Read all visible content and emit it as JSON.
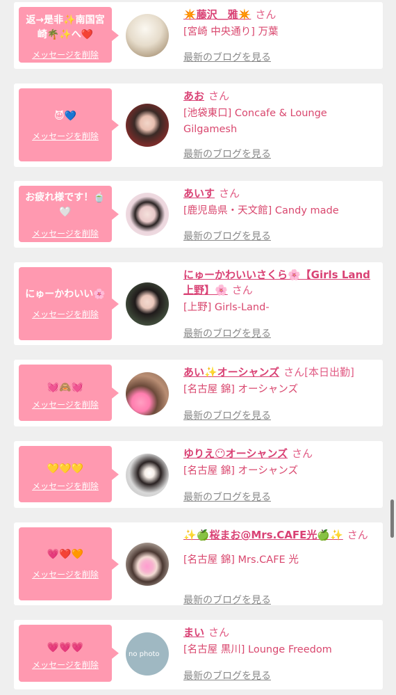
{
  "delete_label": "メッセージを削除",
  "blog_label": "最新のブログを見る",
  "san": "さん",
  "colors": {
    "bubble": "#ff99b0",
    "link": "#d94174",
    "shop": "#d9476e",
    "muted": "#888888",
    "bg": "#efefef"
  },
  "items": [
    {
      "message": "返→是非✨南国宮崎🌴✨へ❤️",
      "name": "✴️藤沢＿雅✴️",
      "tag": "",
      "shop": "[宮崎 中央通り] 万葉",
      "avatar_icon": "blurred-photo-avatar"
    },
    {
      "message": "😈💙",
      "name": "あお",
      "tag": "",
      "shop": "[池袋東口] Concafe & Lounge Gilgamesh",
      "avatar_icon": "girl-photo-avatar"
    },
    {
      "message": "お疲れ様です！🍵🤍",
      "name": "あいす",
      "tag": "",
      "shop": "[鹿児島県・天文館] Candy made",
      "avatar_icon": "girl-photo-avatar"
    },
    {
      "message": "にゅーかわいい🌸",
      "name": "にゅーかわいいさくら🌸【Girls Land上野】🌸",
      "tag": "",
      "shop": "[上野] Girls-Land-",
      "avatar_icon": "girl-photo-avatar"
    },
    {
      "message": "💓🙈💓",
      "name": "あい✨オーシャンズ",
      "tag": "[本日出勤]",
      "shop": "[名古屋 錦] オーシャンズ",
      "avatar_icon": "girl-photo-avatar"
    },
    {
      "message": "💛💛💛",
      "name": "ゆりえ😶オーシャンズ",
      "tag": "",
      "shop": "[名古屋 錦] オーシャンズ",
      "avatar_icon": "girl-photo-avatar"
    },
    {
      "message": "💗❤️🧡",
      "name": "✨🍏桜まお@Mrs.CAFE光🍏✨",
      "tag": "",
      "shop": "[名古屋 錦] Mrs.CAFE 光",
      "avatar_icon": "girl-photo-avatar"
    },
    {
      "message": "💗💗💗",
      "name": "まい",
      "tag": "",
      "shop": "[名古屋 黒川] Lounge Freedom",
      "avatar_icon": "no-photo-avatar",
      "avatar_text": "no photo"
    }
  ]
}
